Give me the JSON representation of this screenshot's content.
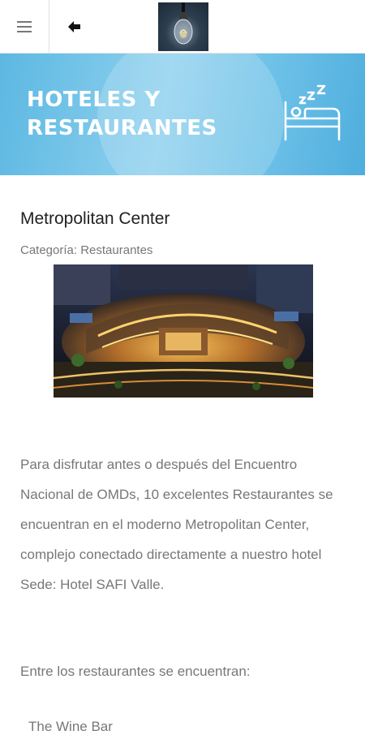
{
  "header": {
    "menu_icon": "hamburger-menu-icon",
    "back_icon": "arrow-left-icon",
    "logo": "light-bulb-logo"
  },
  "banner": {
    "title_line1": "HOTELES Y",
    "title_line2": "RESTAURANTES",
    "icon": "bed-sleep-icon",
    "color": "#6fc2e8"
  },
  "post": {
    "title": "Metropolitan Center",
    "category": "Categoría: Restaurantes",
    "image": "metropolitan-center-aerial-night-photo",
    "paragraph_1": "Para disfrutar antes o después del Encuentro Nacional de OMDs, 10 excelentes Restaurantes se encuentran en el moderno Metropolitan Center, complejo conectado directamente a nuestro hotel Sede: Hotel SAFI Valle.",
    "paragraph_2": "Entre los restaurantes se encuentran:",
    "list_first": "The Wine Bar"
  },
  "colors": {
    "text_muted": "#777777",
    "title_text": "#222222",
    "banner_text": "#ffffff"
  }
}
